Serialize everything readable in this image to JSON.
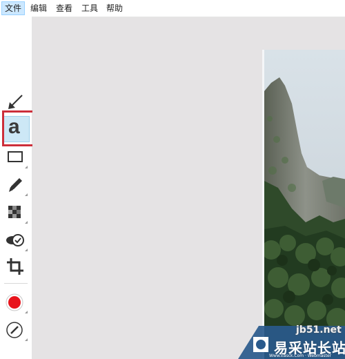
{
  "menu": {
    "items": [
      {
        "label": "文件",
        "active": true
      },
      {
        "label": "编辑",
        "active": false
      },
      {
        "label": "查看",
        "active": false
      },
      {
        "label": "工具",
        "active": false
      },
      {
        "label": "帮助",
        "active": false
      }
    ]
  },
  "toolbar": {
    "tools": [
      {
        "name": "arrow-tool",
        "icon": "arrow-icon"
      },
      {
        "name": "text-tool",
        "icon": "text-a-icon",
        "glyph": "a",
        "selected": true
      },
      {
        "name": "rectangle-tool",
        "icon": "rectangle-icon"
      },
      {
        "name": "pen-tool",
        "icon": "pencil-icon"
      },
      {
        "name": "mosaic-tool",
        "icon": "mosaic-icon"
      },
      {
        "name": "stamp-tool",
        "icon": "stamp-check-icon"
      },
      {
        "name": "crop-tool",
        "icon": "crop-icon"
      },
      {
        "name": "color-picker",
        "icon": "color-dot-icon",
        "color": "#e8141c"
      },
      {
        "name": "line-width-picker",
        "icon": "line-width-icon"
      }
    ]
  },
  "canvas": {
    "background": "#e5e3e4"
  },
  "watermark": {
    "url_text": "jb51.net",
    "brand_text": "易采站长站",
    "sub_text": "Www.Easck.Com · Webmaster"
  },
  "highlight_color": "#cc2e3a"
}
